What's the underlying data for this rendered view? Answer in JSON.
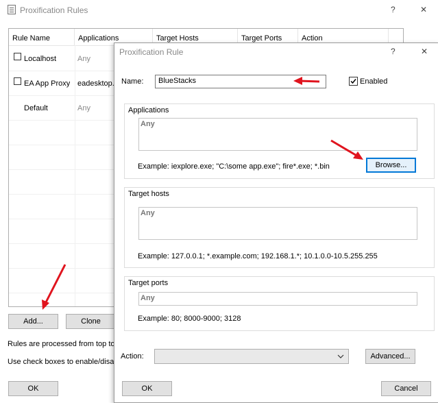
{
  "main": {
    "title": "Proxification Rules",
    "help": "?",
    "close": "✕",
    "columns": [
      "Rule Name",
      "Applications",
      "Target Hosts",
      "Target Ports",
      "Action"
    ],
    "rows": [
      {
        "name": "Localhost",
        "apps": "Any"
      },
      {
        "name": "EA App Proxy",
        "apps": "eadesktop."
      },
      {
        "name": "Default",
        "apps": "Any"
      }
    ],
    "add_label": "Add...",
    "clone_label": "Clone",
    "info1": "Rules are processed from top to",
    "info2": "Use check boxes to enable/disab",
    "ok_label": "OK"
  },
  "dialog": {
    "title": "Proxification Rule",
    "help": "?",
    "close": "✕",
    "name_label": "Name:",
    "name_value": "BlueStacks",
    "enabled_label": "Enabled",
    "apps_title": "Applications",
    "apps_value": "Any",
    "apps_example": "Example: iexplore.exe; \"C:\\some app.exe\"; fire*.exe; *.bin",
    "browse_label": "Browse...",
    "hosts_title": "Target hosts",
    "hosts_value": "Any",
    "hosts_example": "Example: 127.0.0.1; *.example.com; 192.168.1.*; 10.1.0.0-10.5.255.255",
    "ports_title": "Target ports",
    "ports_value": "Any",
    "ports_example": "Example: 80; 8000-9000; 3128",
    "action_label": "Action:",
    "action_value": "",
    "advanced_label": "Advanced...",
    "ok_label": "OK",
    "cancel_label": "Cancel"
  },
  "colors": {
    "annotation_arrow": "#e0141e",
    "focus_border": "#0078d7"
  }
}
